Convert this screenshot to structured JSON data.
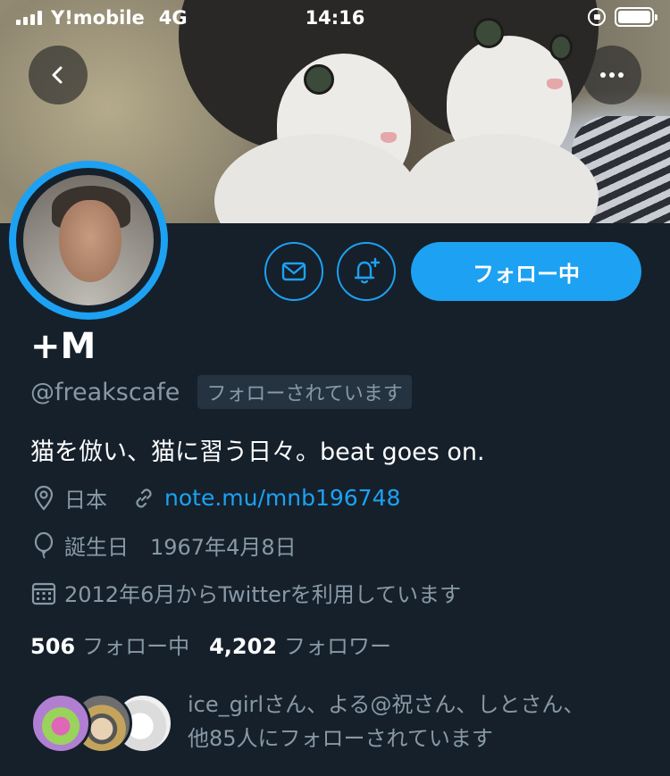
{
  "status_bar": {
    "carrier": "Y!mobile",
    "network": "4G",
    "time": "14:16",
    "signal_bars": 4
  },
  "header": {
    "back_icon": "chevron-left-icon",
    "more_icon": "ellipsis-icon"
  },
  "profile": {
    "display_name": "+M",
    "handle": "@freakscafe",
    "follows_you_badge": "フォローされています",
    "bio": "猫を倣い、猫に習う日々。beat goes on.",
    "location": "日本",
    "website": "note.mu/mnb196748",
    "birthday": "誕生日　1967年4月8日",
    "joined": "2012年6月からTwitterを利用しています"
  },
  "actions": {
    "follow_button_label": "フォロー中",
    "dm_icon": "envelope-icon",
    "notify_icon": "bell-plus-icon"
  },
  "stats": {
    "following_count": "506",
    "following_label": "フォロー中",
    "followers_count": "4,202",
    "followers_label": "フォロワー"
  },
  "followed_by": {
    "line1": "ice_girlさん、よる@祝さん、しとさん、",
    "line2": "他85人にフォローされています"
  },
  "colors": {
    "background": "#15202b",
    "accent": "#1da1f2",
    "secondary_text": "#8899a6",
    "primary_text": "#ffffff"
  }
}
